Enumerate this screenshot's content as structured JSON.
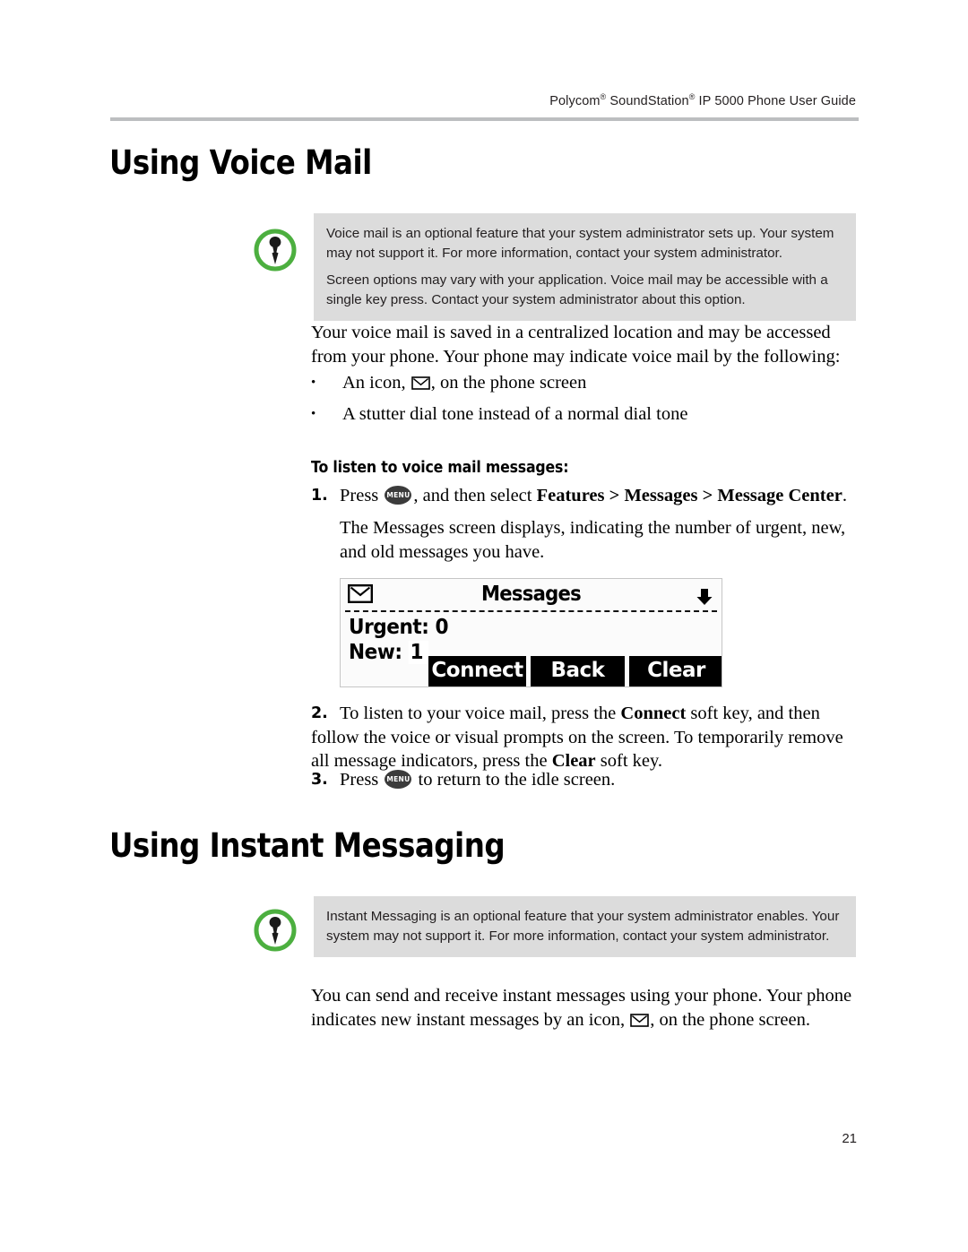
{
  "header": {
    "running_title_prefix": "Polycom",
    "running_title_mid": " SoundStation",
    "running_title_suffix": " IP 5000 Phone User Guide",
    "registered_mark": "®"
  },
  "sections": {
    "voice_mail": {
      "heading": "Using Voice Mail",
      "note": {
        "icon": "note-pin-icon",
        "paragraphs": [
          "Voice mail is an optional feature that your system administrator sets up. Your system may not support it. For more information, contact your system administrator.",
          "Screen options may vary with your application. Voice mail may be accessible with a single key press. Contact your system administrator about this option."
        ]
      },
      "intro": "Your voice mail is saved in a centralized location and may be accessed from your phone. Your phone may indicate voice mail by the following:",
      "bullets": [
        {
          "mark": "•",
          "before": "An icon, ",
          "icon": "envelope-icon",
          "after": ", on the phone screen"
        },
        {
          "mark": "•",
          "text": "A stutter dial tone instead of a normal dial tone"
        }
      ],
      "procedure_heading": "To listen to voice mail messages:",
      "steps": [
        {
          "number": "1.",
          "pre": "Press ",
          "key": "MENU",
          "mid": ", and then select ",
          "bold1": "Features",
          "sep1": " > ",
          "bold2": "Messages",
          "sep2": " > ",
          "bold3": "Message Center",
          "end": "."
        },
        {
          "number": "2.",
          "pre": "To listen to your voice mail, press the ",
          "bold1": "Connect",
          "mid": " soft key, and then follow the voice or visual prompts on the screen. To temporarily remove all message indicators, press the ",
          "bold2": "Clear",
          "end": " soft key."
        },
        {
          "number": "3.",
          "pre": "Press ",
          "key": "MENU",
          "end": " to return to the idle screen."
        }
      ],
      "step1_result": "The Messages screen displays, indicating the number of urgent, new, and old messages you have."
    },
    "instant_messaging": {
      "heading": "Using Instant Messaging",
      "note": {
        "icon": "note-pin-icon",
        "paragraphs": [
          "Instant Messaging is an optional feature that your system administrator enables. Your system may not support it. For more information, contact your system administrator."
        ]
      },
      "intro_before": "You can send and receive instant messages using your phone. Your phone indicates new instant messages by an icon, ",
      "intro_icon": "envelope-icon",
      "intro_after": ", on the phone screen."
    }
  },
  "phone_screen": {
    "status_icon": "envelope-icon",
    "title": "Messages",
    "scroll_indicator": "arrow-down-icon",
    "lines": [
      {
        "label": "Urgent: ",
        "value": "0",
        "highlighted": false
      },
      {
        "label": "New: ",
        "value": "1",
        "highlighted": true
      }
    ],
    "softkeys": [
      {
        "label": "Connect"
      },
      {
        "label": "Back"
      },
      {
        "label": "Clear"
      }
    ]
  },
  "footer": {
    "page_number": "21"
  },
  "colors": {
    "note_background": "#dcdcdc",
    "note_icon_green": "#4caf3f",
    "header_rule": "#bcbec0",
    "text": "#000000",
    "menu_key": "#3b3b3b"
  }
}
